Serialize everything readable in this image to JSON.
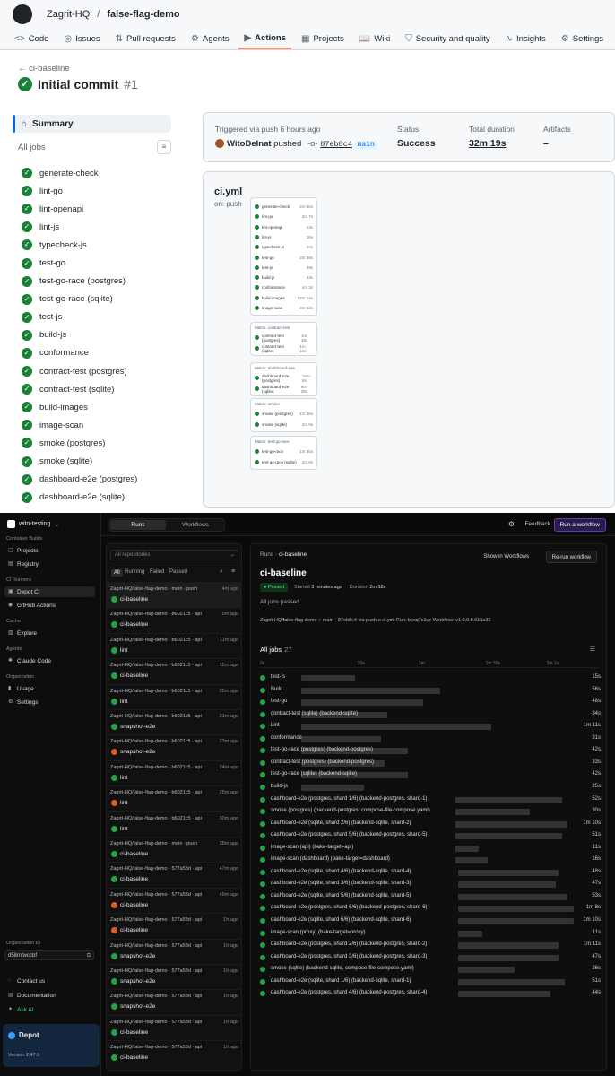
{
  "github": {
    "org": "Zagrit-HQ",
    "sep": "/",
    "repo": "false-flag-demo",
    "tabs": [
      {
        "label": "Code",
        "icon": "<>"
      },
      {
        "label": "Issues",
        "icon": "◎"
      },
      {
        "label": "Pull requests",
        "icon": "⇅"
      },
      {
        "label": "Agents",
        "icon": "⚙"
      },
      {
        "label": "Actions",
        "icon": "▶",
        "active": true
      },
      {
        "label": "Projects",
        "icon": "▦"
      },
      {
        "label": "Wiki",
        "icon": "📖"
      },
      {
        "label": "Security and quality",
        "icon": "⛉"
      },
      {
        "label": "Insights",
        "icon": "∿"
      },
      {
        "label": "Settings",
        "icon": "⚙"
      }
    ],
    "back": "ci-baseline",
    "title": "Initial commit",
    "run_number": "#1",
    "summary": "Summary",
    "all_jobs": "All jobs",
    "jobs": [
      "generate-check",
      "lint-go",
      "lint-openapi",
      "lint-js",
      "typecheck-js",
      "test-go",
      "test-go-race (postgres)",
      "test-go-race (sqlite)",
      "test-js",
      "build-js",
      "conformance",
      "contract-test (postgres)",
      "contract-test (sqlite)",
      "build-images",
      "image-scan",
      "smoke (postgres)",
      "smoke (sqlite)",
      "dashboard-e2e (postgres)",
      "dashboard-e2e (sqlite)"
    ],
    "triggered": "Triggered via push 6 hours ago",
    "user": "WitoDelnat",
    "pushed": "pushed",
    "commit": "87eb8c4",
    "branch": "main",
    "status_label": "Status",
    "status_value": "Success",
    "duration_label": "Total duration",
    "duration_value": "32m 19s",
    "artifacts_label": "Artifacts",
    "artifacts_value": "–",
    "workflow_file": "ci.yml",
    "workflow_on": "on: push",
    "mini_jobs": [
      {
        "n": "generate-check",
        "t": "2m 56s"
      },
      {
        "n": "lint-go",
        "t": "2m 7s"
      },
      {
        "n": "lint-openapi",
        "t": "13s"
      },
      {
        "n": "lint-js",
        "t": "18s"
      },
      {
        "n": "typecheck-js",
        "t": "28s"
      },
      {
        "n": "test-go",
        "t": "2m 58s"
      },
      {
        "n": "test-js",
        "t": "39s"
      },
      {
        "n": "build-js",
        "t": "43s"
      },
      {
        "n": "conformance",
        "t": "1m 3s"
      },
      {
        "n": "build-images",
        "t": "32m 14s"
      },
      {
        "n": "image-scan",
        "t": "4m 33s"
      }
    ],
    "mini_groups": [
      {
        "head": "Matrix: contract-test",
        "rows": [
          {
            "n": "contract-test (postgres)",
            "t": "1m 36s"
          },
          {
            "n": "contract-test (sqlite)",
            "t": "1m 18s"
          }
        ]
      },
      {
        "head": "Matrix: dashboard-e2e",
        "rows": [
          {
            "n": "dashboard-e2e (postgres)",
            "t": "10m 8s"
          },
          {
            "n": "dashboard-e2e (sqlite)",
            "t": "9m 39s"
          }
        ]
      },
      {
        "head": "Matrix: smoke",
        "rows": [
          {
            "n": "smoke (postgres)",
            "t": "1m 35s"
          },
          {
            "n": "smoke (sqlite)",
            "t": "1m 9s"
          }
        ]
      },
      {
        "head": "Matrix: test-go-race",
        "rows": [
          {
            "n": "test-go-race",
            "t": "1m 35s"
          },
          {
            "n": "test-go-race (sqlite)",
            "t": "1m 8s"
          }
        ]
      }
    ]
  },
  "depot": {
    "org": "wito-testing",
    "nav": [
      {
        "sec": "Container Builds"
      },
      {
        "label": "Projects",
        "icon": "▢"
      },
      {
        "label": "Registry",
        "icon": "▤"
      },
      {
        "sec": "CI Runners"
      },
      {
        "label": "Depot CI",
        "icon": "▣",
        "sel": true
      },
      {
        "label": "GitHub Actions",
        "icon": "◉"
      },
      {
        "sec": "Cache"
      },
      {
        "label": "Explore",
        "icon": "▥"
      },
      {
        "sec": "Agents"
      },
      {
        "label": "Claude Code",
        "icon": "✱"
      },
      {
        "sec": "Organization"
      },
      {
        "label": "Usage",
        "icon": "▮"
      },
      {
        "label": "Settings",
        "icon": "⚙"
      }
    ],
    "org_id_label": "Organization ID",
    "org_id": "d58mfwccbf",
    "bottom_nav": [
      {
        "label": "Contact us",
        "icon": "◌"
      },
      {
        "label": "Documentation",
        "icon": "▤"
      },
      {
        "label": "Ask AI",
        "icon": "✦",
        "accent": true
      }
    ],
    "brand": "Depot",
    "version": "Version 2.47.0",
    "seg_runs": "Runs",
    "seg_workflows": "Workflows",
    "feedback": "Feedback",
    "run_workflow": "Run a workflow",
    "repos_placeholder": "All repositories",
    "filters": [
      "All",
      "Running",
      "Failed",
      "Passed"
    ],
    "runs": [
      {
        "repo": "Zagrit-HQ/false-flag-demo · main · push",
        "age": "4m ago",
        "name": "ci-baseline",
        "fail": false,
        "sel": true
      },
      {
        "repo": "Zagrit-HQ/false-flag-demo · b6021c5 · api",
        "age": "9m ago",
        "name": "ci-baseline",
        "fail": false
      },
      {
        "repo": "Zagrit-HQ/false-flag-demo · b6021c5 · api",
        "age": "11m ago",
        "name": "lint",
        "fail": false
      },
      {
        "repo": "Zagrit-HQ/false-flag-demo · b6021c5 · api",
        "age": "15m ago",
        "name": "ci-baseline",
        "fail": false
      },
      {
        "repo": "Zagrit-HQ/false-flag-demo · b6021c5 · api",
        "age": "25m ago",
        "name": "lint",
        "fail": false
      },
      {
        "repo": "Zagrit-HQ/false-flag-demo · b6021c5 · api",
        "age": "21m ago",
        "name": "snapshot-e2e",
        "fail": false
      },
      {
        "repo": "Zagrit-HQ/false-flag-demo · b6021c5 · api",
        "age": "23m ago",
        "name": "snapshot-e2e",
        "fail": true
      },
      {
        "repo": "Zagrit-HQ/false-flag-demo · b6021c5 · api",
        "age": "24m ago",
        "name": "lint",
        "fail": false
      },
      {
        "repo": "Zagrit-HQ/false-flag-demo · b6021c5 · api",
        "age": "25m ago",
        "name": "lint",
        "fail": true
      },
      {
        "repo": "Zagrit-HQ/false-flag-demo · b6021c5 · api",
        "age": "30m ago",
        "name": "lint",
        "fail": false
      },
      {
        "repo": "Zagrit-HQ/false-flag-demo · main · push",
        "age": "38m ago",
        "name": "ci-baseline",
        "fail": false
      },
      {
        "repo": "Zagrit-HQ/false-flag-demo · 577a53d · api",
        "age": "47m ago",
        "name": "ci-baseline",
        "fail": false
      },
      {
        "repo": "Zagrit-HQ/false-flag-demo · 577a53d · api",
        "age": "49m ago",
        "name": "ci-baseline",
        "fail": true
      },
      {
        "repo": "Zagrit-HQ/false-flag-demo · 577a53d · api",
        "age": "1h ago",
        "name": "ci-baseline",
        "fail": true
      },
      {
        "repo": "Zagrit-HQ/false-flag-demo · 577a53d · api",
        "age": "1h ago",
        "name": "snapshot-e2e",
        "fail": false
      },
      {
        "repo": "Zagrit-HQ/false-flag-demo · 577a53d · api",
        "age": "1h ago",
        "name": "snapshot-e2e",
        "fail": false
      },
      {
        "repo": "Zagrit-HQ/false-flag-demo · 577a53d · api",
        "age": "1h ago",
        "name": "snapshot-e2e",
        "fail": false
      },
      {
        "repo": "Zagrit-HQ/false-flag-demo · 577a53d · api",
        "age": "1h ago",
        "name": "ci-baseline",
        "fail": false
      },
      {
        "repo": "Zagrit-HQ/false-flag-demo · 577a53d · api",
        "age": "1h ago",
        "name": "ci-baseline",
        "fail": false
      }
    ],
    "crumb_runs": "Runs",
    "crumb_name": "ci-baseline",
    "show_in_workflows": "Show in Workflows",
    "rerun": "Re-run workflow",
    "title": "ci-baseline",
    "badge": "Passed",
    "started_label": "Started",
    "started": "3 minutes ago",
    "duration_label": "Duration",
    "duration": "2m 18s",
    "all_jobs_passed": "All jobs passed",
    "info": "Zagrit-HQ/false-flag-demo   ⑂ main   ◦ 87eb8c4 via push   ▯ ci.yml   Run: bcxq7c1cz   Workflow: v1.0.0.8.615a31",
    "all_jobs": "All jobs",
    "job_count": "27",
    "axis_ticks": [
      {
        "l": "0s",
        "p": 0
      },
      {
        "l": "30s",
        "p": 0.32
      },
      {
        "l": "1m",
        "p": 0.52
      },
      {
        "l": "1m 30s",
        "p": 0.74
      },
      {
        "l": "2m 1s",
        "p": 0.94
      }
    ],
    "gantt": [
      {
        "n": "test-js",
        "s": 0.08,
        "w": 0.18,
        "d": "15s"
      },
      {
        "n": "Build",
        "s": 0.08,
        "w": 0.47,
        "d": "56s"
      },
      {
        "n": "test-go",
        "s": 0.08,
        "w": 0.41,
        "d": "48s"
      },
      {
        "n": "contract-test (sqlite) (backend-sqlite)",
        "s": 0.08,
        "w": 0.29,
        "d": "34s"
      },
      {
        "n": "Lint",
        "s": 0.08,
        "w": 0.64,
        "d": "1m 11s"
      },
      {
        "n": "conformance",
        "s": 0.08,
        "w": 0.27,
        "d": "31s"
      },
      {
        "n": "test-go-race (postgres) (backend-postgres)",
        "s": 0.08,
        "w": 0.36,
        "d": "42s"
      },
      {
        "n": "contract-test (postgres) (backend-postgres)",
        "s": 0.08,
        "w": 0.28,
        "d": "33s"
      },
      {
        "n": "test-go-race (sqlite) (backend-sqlite)",
        "s": 0.08,
        "w": 0.36,
        "d": "42s"
      },
      {
        "n": "build-js",
        "s": 0.08,
        "w": 0.21,
        "d": "25s"
      },
      {
        "n": "dashboard-e2e (postgres, shard 1/6) (backend-postgres, shard-1)",
        "s": 0.6,
        "w": 0.36,
        "d": "52s"
      },
      {
        "n": "smoke (postgres) (backend-postgres, compose-file-compose.yaml)",
        "s": 0.6,
        "w": 0.25,
        "d": "30s"
      },
      {
        "n": "dashboard-e2e (sqlite, shard 2/6) (backend-sqlite, shard-2)",
        "s": 0.6,
        "w": 0.38,
        "d": "1m 10s"
      },
      {
        "n": "dashboard-e2e (postgres, shard 5/6) (backend-postgres, shard-5)",
        "s": 0.6,
        "w": 0.36,
        "d": "51s"
      },
      {
        "n": "image-scan (api) (bake-target=api)",
        "s": 0.6,
        "w": 0.08,
        "d": "11s"
      },
      {
        "n": "image-scan (dashboard) (bake-target=dashboard)",
        "s": 0.6,
        "w": 0.11,
        "d": "16s"
      },
      {
        "n": "dashboard-e2e (sqlite, shard 4/6) (backend-sqlite, shard-4)",
        "s": 0.61,
        "w": 0.34,
        "d": "48s"
      },
      {
        "n": "dashboard-e2e (sqlite, shard 3/6) (backend-sqlite, shard-3)",
        "s": 0.61,
        "w": 0.33,
        "d": "47s"
      },
      {
        "n": "dashboard-e2e (sqlite, shard 5/6) (backend-sqlite, shard-5)",
        "s": 0.61,
        "w": 0.37,
        "d": "53s"
      },
      {
        "n": "dashboard-e2e (postgres, shard 6/6) (backend-postgres, shard-6)",
        "s": 0.61,
        "w": 0.39,
        "d": "1m 8s"
      },
      {
        "n": "dashboard-e2e (sqlite, shard 6/6) (backend-sqlite, shard-6)",
        "s": 0.61,
        "w": 0.39,
        "d": "1m 10s"
      },
      {
        "n": "image-scan (proxy) (bake-target=proxy)",
        "s": 0.61,
        "w": 0.08,
        "d": "11s"
      },
      {
        "n": "dashboard-e2e (postgres, shard 2/6) (backend-postgres, shard-2)",
        "s": 0.61,
        "w": 0.34,
        "d": "1m 11s"
      },
      {
        "n": "dashboard-e2e (postgres, shard 3/6) (backend-postgres, shard-3)",
        "s": 0.61,
        "w": 0.34,
        "d": "47s"
      },
      {
        "n": "smoke (sqlite) (backend-sqlite, compose-file-compose.yaml)",
        "s": 0.61,
        "w": 0.19,
        "d": "26s"
      },
      {
        "n": "dashboard-e2e (sqlite, shard 1/6) (backend-sqlite, shard-1)",
        "s": 0.61,
        "w": 0.36,
        "d": "51s"
      },
      {
        "n": "dashboard-e2e (postgres, shard 4/6) (backend-postgres, shard-4)",
        "s": 0.61,
        "w": 0.31,
        "d": "44s"
      }
    ]
  }
}
